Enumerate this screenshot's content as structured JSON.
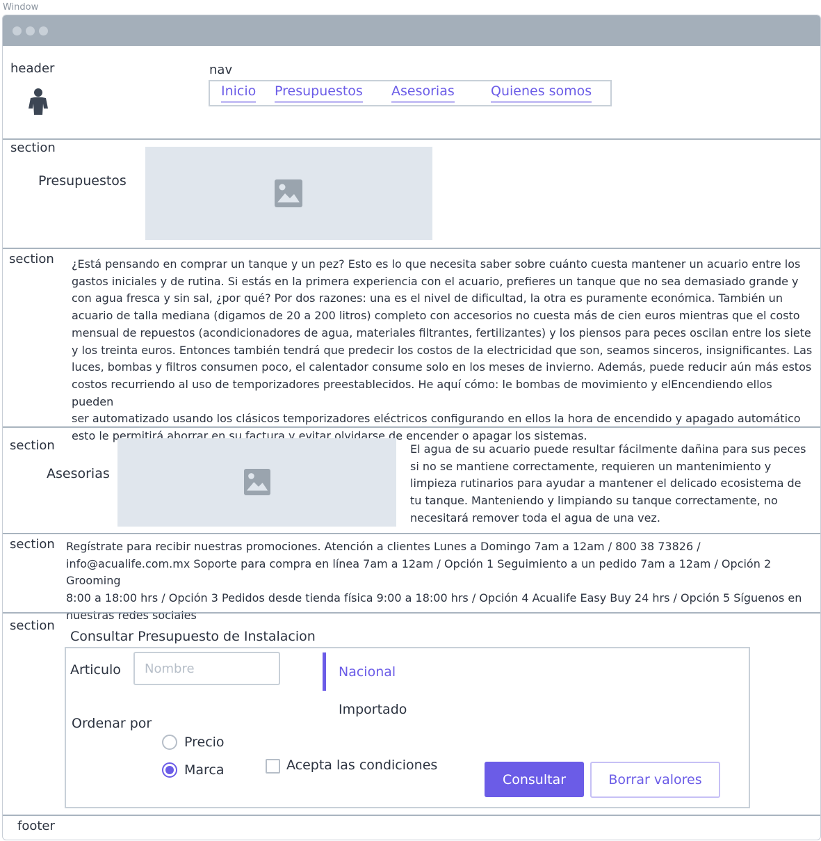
{
  "window": {
    "label": "Window"
  },
  "header": {
    "label": "header",
    "avatar_icon": "user-icon"
  },
  "nav": {
    "label": "nav",
    "links": [
      {
        "label": "Inicio"
      },
      {
        "label": "Presupuestos"
      },
      {
        "label": "Asesorias"
      },
      {
        "label": "Quienes somos"
      }
    ]
  },
  "section_presupuestos": {
    "label": "section",
    "heading": "Presupuestos",
    "image_icon": "image-icon"
  },
  "section_text": {
    "label": "section",
    "lines": [
      "¿Está pensando en comprar un tanque y un pez? Esto es lo que necesita saber sobre cuánto cuesta mantener un acuario entre los",
      "gastos iniciales y de rutina. Si estás en la primera experiencia con el acuario, prefieres un tanque que no sea demasiado grande y",
      "con agua fresca y sin sal, ¿por qué? Por dos razones: una es el nivel de dificultad, la otra es puramente económica. También un",
      "acuario de talla mediana (digamos de 20 a 200 litros) completo con accesorios no cuesta más de cien euros mientras que el costo",
      "mensual de repuestos (acondicionadores de agua, materiales filtrantes, fertilizantes) y los piensos para peces oscilan entre los siete",
      "y los treinta euros. Entonces también tendrá que predecir los costos de la electricidad que son, seamos sinceros, insignificantes. Las",
      "luces, bombas y filtros consumen poco, el calentador consume solo en los meses de invierno. Además, puede reducir aún más estos",
      "costos recurriendo al uso de temporizadores preestablecidos. He aquí cómo: le bombas de movimiento y elEncendiendo ellos pueden",
      "ser automatizado usando los clásicos temporizadores eléctricos configurando en ellos la hora de encendido y apagado automático",
      "esto le permitirá ahorrar en su factura y evitar olvidarse de encender o apagar los sistemas."
    ]
  },
  "section_asesorias": {
    "label": "section",
    "heading": "Asesorias",
    "image_icon": "image-icon",
    "lines": [
      "El agua de su acuario puede resultar fácilmente dañina para sus peces",
      "si no se mantiene correctamente, requieren un mantenimiento y",
      "limpieza rutinarios para ayudar a mantener el delicado ecosistema de",
      "tu tanque. Manteniendo y limpiando su tanque correctamente, no",
      "necesitará remover toda el agua de una vez."
    ]
  },
  "section_contact": {
    "label": "section",
    "lines": [
      "Regístrate para recibir nuestras promociones. Atención a clientes Lunes a Domingo 7am a 12am / 800 38 73826 /",
      "info@acualife.com.mx Soporte para compra en línea 7am a 12am / Opción 1 Seguimiento a un pedido 7am a 12am / Opción 2 Grooming",
      "8:00 a 18:00 hrs / Opción 3 Pedidos desde tienda física 9:00 a 18:00 hrs / Opción 4 Acualife Easy Buy 24 hrs / Opción 5 Síguenos en",
      "nuestras redes sociales"
    ]
  },
  "section_form": {
    "label": "section",
    "title": "Consultar Presupuesto de Instalacion",
    "articulo_label": "Articulo",
    "articulo_placeholder": "Nombre",
    "origin_options": [
      {
        "label": "Nacional",
        "selected": true
      },
      {
        "label": "Importado",
        "selected": false
      }
    ],
    "order_label": "Ordenar por",
    "order_options": [
      {
        "label": "Precio",
        "checked": false
      },
      {
        "label": "Marca",
        "checked": true
      }
    ],
    "accept_label": "Acepta las condiciones",
    "accept_checked": false,
    "submit_label": "Consultar",
    "reset_label": "Borrar valores"
  },
  "footer": {
    "label": "footer"
  },
  "colors": {
    "accent": "#6b5ce7",
    "titlebar": "#a4afba",
    "divider": "#a9b4bf",
    "placeholder": "#e0e6ed"
  }
}
